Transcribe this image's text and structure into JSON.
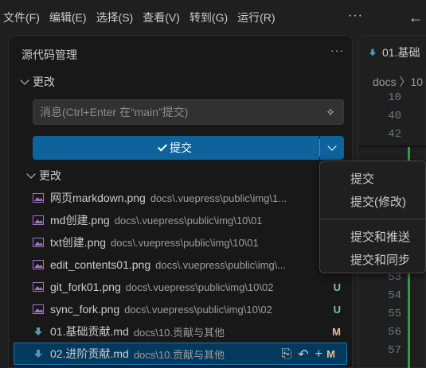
{
  "menubar": {
    "items": [
      "文件(F)",
      "编辑(E)",
      "选择(S)",
      "查看(V)",
      "转到(G)",
      "运行(R)"
    ],
    "more": "···"
  },
  "scm": {
    "title": "源代码管理",
    "section_label": "更改",
    "message_placeholder": "消息(Ctrl+Enter 在“main”提交)",
    "commit_label": "提交",
    "changes_label": "更改",
    "files": [
      {
        "name": "网页markdown.png",
        "path": "docs\\.vuepress\\public\\img\\1...",
        "status": "",
        "type": "image"
      },
      {
        "name": "md创建.png",
        "path": "docs\\.vuepress\\public\\img\\10\\01",
        "status": "",
        "type": "image"
      },
      {
        "name": "txt创建.png",
        "path": "docs\\.vuepress\\public\\img\\10\\01",
        "status": "",
        "type": "image"
      },
      {
        "name": "edit_contents01.png",
        "path": "docs\\.vuepress\\public\\img\\...",
        "status": "",
        "type": "image"
      },
      {
        "name": "git_fork01.png",
        "path": "docs\\.vuepress\\public\\img\\10\\02",
        "status": "U",
        "type": "image"
      },
      {
        "name": "sync_fork.png",
        "path": "docs\\.vuepress\\public\\img\\10\\02",
        "status": "U",
        "type": "image"
      },
      {
        "name": "01.基础贡献.md",
        "path": "docs\\10.贡献与其他",
        "status": "M",
        "type": "markdown"
      },
      {
        "name": "02.进阶贡献.md",
        "path": "docs\\10.贡献与其他",
        "status": "M",
        "type": "markdown"
      }
    ]
  },
  "editor": {
    "tab_label": "01.基础",
    "breadcrumb": "docs 〉10",
    "line_numbers_top": [
      "10",
      "40",
      "42"
    ],
    "line_numbers_bottom": [
      "53",
      "54",
      "55",
      "56",
      "57"
    ]
  },
  "dropdown": {
    "items": [
      "提交",
      "提交(修改)",
      "提交和推送",
      "提交和同步"
    ]
  },
  "colors": {
    "accent": "#0e639c",
    "untracked": "#73c991",
    "modified": "#e2c08d",
    "markdown_icon": "#519aba",
    "image_icon": "#a074c4"
  }
}
